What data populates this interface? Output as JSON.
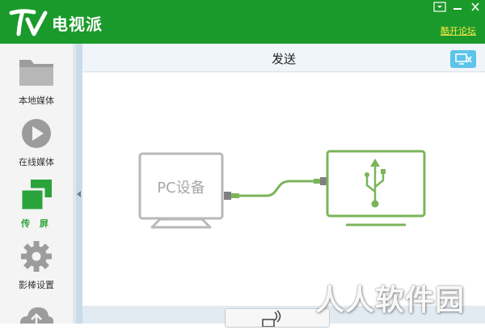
{
  "app": {
    "title": "电视派",
    "forum_link": "酷开论坛",
    "colors": {
      "brand": "#1a9a2a",
      "accent": "#2aa33a",
      "link": "#ffe84a"
    }
  },
  "sidebar": {
    "items": [
      {
        "label": "本地媒体",
        "icon": "folder-icon"
      },
      {
        "label": "在线媒体",
        "icon": "play-circle-icon"
      },
      {
        "label": "传 屏",
        "icon": "screen-mirror-icon",
        "active": true
      },
      {
        "label": "影棒设置",
        "icon": "gear-icon"
      },
      {
        "label": "",
        "icon": "cloud-upload-icon"
      }
    ]
  },
  "main": {
    "title": "发送",
    "pc_device_label": "PC设备"
  },
  "watermark": "人人软件园"
}
